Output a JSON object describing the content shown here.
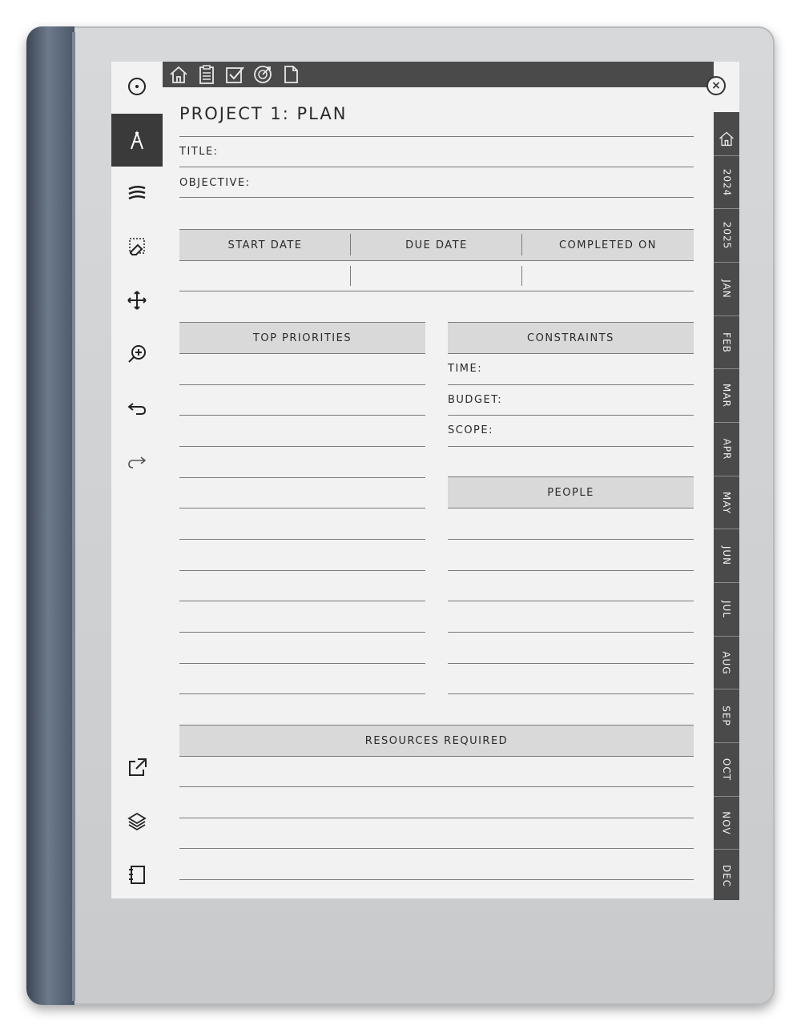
{
  "page": {
    "title": "PROJECT 1: PLAN",
    "fields": {
      "title_label": "TITLE:",
      "objective_label": "OBJECTIVE:"
    },
    "dates": {
      "start": "START DATE",
      "due": "DUE DATE",
      "completed": "COMPLETED ON"
    },
    "top_priorities": "TOP PRIORITIES",
    "constraints": {
      "header": "CONSTRAINTS",
      "time": "TIME:",
      "budget": "BUDGET:",
      "scope": "SCOPE:"
    },
    "people": "PEOPLE",
    "resources": "RESOURCES REQUIRED"
  },
  "tabs": [
    "2024",
    "2025",
    "JAN",
    "FEB",
    "MAR",
    "APR",
    "MAY",
    "JUN",
    "JUL",
    "AUG",
    "SEP",
    "OCT",
    "NOV",
    "DEC"
  ],
  "topbar_icons": [
    "home-icon",
    "clipboard-icon",
    "checkbox-icon",
    "target-icon",
    "page-icon"
  ],
  "toolbar_icons": [
    "menu-circle-icon",
    "pen-icon",
    "brush-icon",
    "eraser-icon",
    "move-icon",
    "zoom-icon",
    "undo-icon",
    "redo-icon",
    "share-icon",
    "layers-icon",
    "notebook-icon"
  ],
  "close_glyph": "×",
  "colors": {
    "bar": "#4a4a4a",
    "screen": "#f2f2f2",
    "header_fill": "#d9d9d9"
  }
}
